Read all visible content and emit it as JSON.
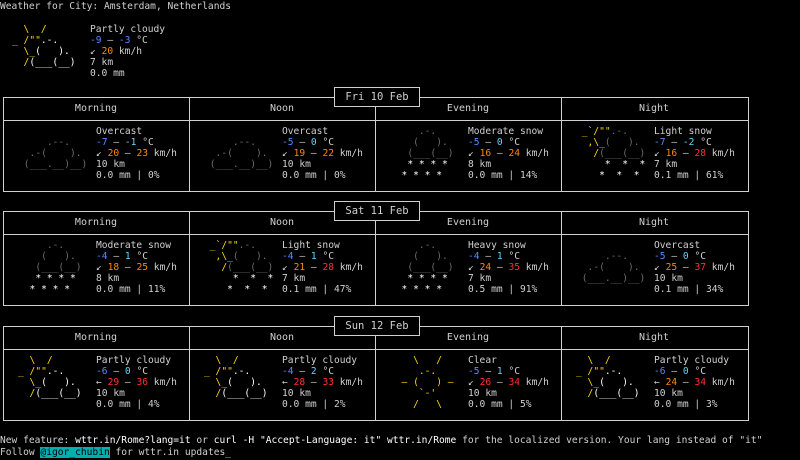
{
  "header": {
    "title": "Weather for City: Amsterdam, Netherlands"
  },
  "current": {
    "icon": "partly-cloudy",
    "condition": "Partly cloudy",
    "temp_a": "-9",
    "temp_sep": " – ",
    "temp_b": "-3",
    "temp_unit": " °C",
    "wind_arrow": "↙",
    "wind_speed": "20",
    "wind_unit": " km/h",
    "visibility": "7 km",
    "precip": "0.0 mm"
  },
  "periods": [
    "Morning",
    "Noon",
    "Evening",
    "Night"
  ],
  "days": [
    {
      "date": "Fri 10 Feb",
      "slots": [
        {
          "icon": "overcast",
          "condition": "Overcast",
          "t1": "-7",
          "t2": "-1",
          "arrow": "↙",
          "w1": "20",
          "w2": "23",
          "vis": "10 km",
          "precip": "0.0 mm",
          "chance": "0%"
        },
        {
          "icon": "overcast",
          "condition": "Overcast",
          "t1": "-5",
          "t2": "0",
          "arrow": "↙",
          "w1": "19",
          "w2": "22",
          "vis": "10 km",
          "precip": "0.0 mm",
          "chance": "0%"
        },
        {
          "icon": "moderate-snow",
          "condition": "Moderate snow",
          "t1": "-5",
          "t2": "0",
          "arrow": "↙",
          "w1": "16",
          "w2": "24",
          "vis": "8 km",
          "precip": "0.0 mm",
          "chance": "14%"
        },
        {
          "icon": "light-snow",
          "condition": "Light snow",
          "t1": "-7",
          "t2": "-2",
          "arrow": "↙",
          "w1": "16",
          "w2": "28",
          "vis": "7 km",
          "precip": "0.1 mm",
          "chance": "61%"
        }
      ]
    },
    {
      "date": "Sat 11 Feb",
      "slots": [
        {
          "icon": "moderate-snow",
          "condition": "Moderate snow",
          "t1": "-4",
          "t2": "1",
          "arrow": "↙",
          "w1": "18",
          "w2": "25",
          "vis": "8 km",
          "precip": "0.0 mm",
          "chance": "11%"
        },
        {
          "icon": "light-snow",
          "condition": "Light snow",
          "t1": "-4",
          "t2": "1",
          "arrow": "↙",
          "w1": "21",
          "w2": "28",
          "vis": "7 km",
          "precip": "0.1 mm",
          "chance": "47%"
        },
        {
          "icon": "heavy-snow",
          "condition": "Heavy snow",
          "t1": "-4",
          "t2": "1",
          "arrow": "↙",
          "w1": "24",
          "w2": "35",
          "vis": "7 km",
          "precip": "0.5 mm",
          "chance": "91%"
        },
        {
          "icon": "overcast",
          "condition": "Overcast",
          "t1": "-5",
          "t2": "0",
          "arrow": "↙",
          "w1": "25",
          "w2": "37",
          "vis": "10 km",
          "precip": "0.1 mm",
          "chance": "34%"
        }
      ]
    },
    {
      "date": "Sun 12 Feb",
      "slots": [
        {
          "icon": "partly-cloudy",
          "condition": "Partly cloudy",
          "t1": "-6",
          "t2": "0",
          "arrow": "←",
          "w1": "29",
          "w2": "36",
          "vis": "10 km",
          "precip": "0.0 mm",
          "chance": "4%"
        },
        {
          "icon": "partly-cloudy",
          "condition": "Partly cloudy",
          "t1": "-4",
          "t2": "2",
          "arrow": "←",
          "w1": "28",
          "w2": "33",
          "vis": "10 km",
          "precip": "0.0 mm",
          "chance": "2%"
        },
        {
          "icon": "clear",
          "condition": "Clear",
          "t1": "-5",
          "t2": "1",
          "arrow": "↙",
          "w1": "26",
          "w2": "34",
          "vis": "10 km",
          "precip": "0.0 mm",
          "chance": "5%"
        },
        {
          "icon": "partly-cloudy",
          "condition": "Partly cloudy",
          "t1": "-6",
          "t2": "0",
          "arrow": "←",
          "w1": "24",
          "w2": "34",
          "vis": "10 km",
          "precip": "0.0 mm",
          "chance": "3%"
        }
      ]
    }
  ],
  "units": {
    "temp": " °C",
    "wind": " km/h",
    "sep": " – "
  },
  "footer": {
    "line1_a": "New feature: ",
    "line1_url1": "wttr.in/Rome?lang=it",
    "line1_b": " or ",
    "line1_cmd": "curl -H \"Accept-Language: it\" wttr.in/Rome",
    "line1_c": " for the localized version. Your lang instead of \"it\"",
    "line2_a": "Follow ",
    "line2_handle": "@igor_chubin",
    "line2_b": " for wttr.in updates"
  }
}
